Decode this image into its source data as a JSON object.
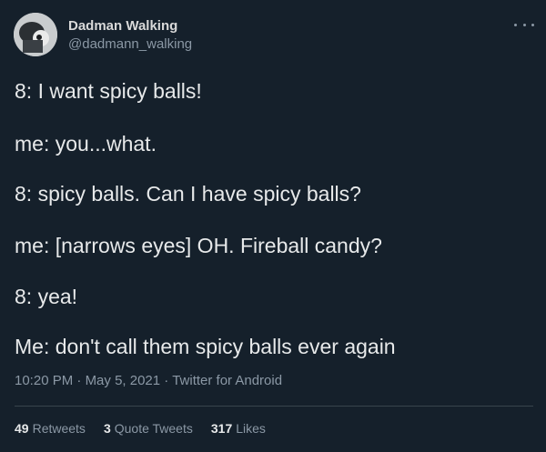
{
  "author": {
    "display_name": "Dadman Walking",
    "handle": "@dadmann_walking"
  },
  "icons": {
    "more": "more-horizontal-icon"
  },
  "tweet": {
    "lines": [
      "8: I want spicy balls!",
      "me: you...what.",
      "8: spicy balls. Can I have spicy balls?",
      "me: [narrows eyes] OH. Fireball candy?",
      "8: yea!",
      "Me: don't call them spicy balls ever again"
    ]
  },
  "meta": {
    "time": "10:20 PM",
    "separator1": " · ",
    "date": "May 5, 2021",
    "separator2": " · ",
    "source": "Twitter for Android"
  },
  "stats": {
    "retweets_count": "49",
    "retweets_label": "Retweets",
    "quotes_count": "3",
    "quotes_label": "Quote Tweets",
    "likes_count": "317",
    "likes_label": "Likes"
  },
  "colors": {
    "background": "#15202b",
    "text": "#e7e9ea",
    "secondary_text": "#8b98a5",
    "divider": "#38444d"
  }
}
